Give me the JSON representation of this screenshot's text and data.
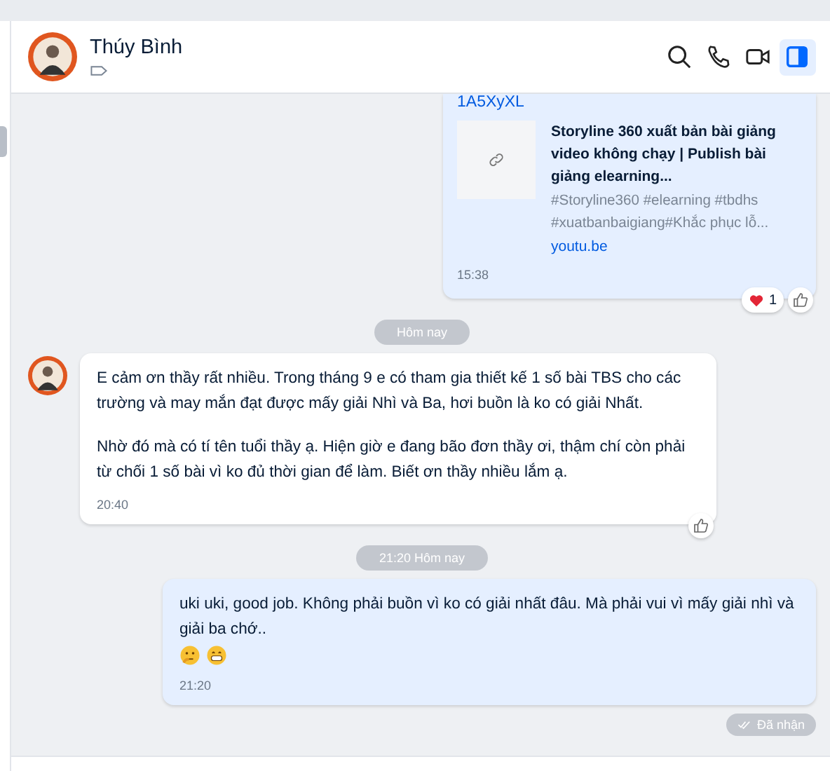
{
  "header": {
    "name": "Thúy Bình",
    "actions": [
      {
        "kind": "search",
        "selected": false
      },
      {
        "kind": "call",
        "selected": false
      },
      {
        "kind": "video",
        "selected": false
      },
      {
        "kind": "panel",
        "selected": true
      }
    ]
  },
  "messages": [
    {
      "kind": "link",
      "outgoing": true,
      "url_text": "1A5XyXL",
      "title": "Storyline 360 xuất bản bài giảng video không chạy | Publish bài giảng elearning...",
      "description": "#Storyline360 #elearning #tbdhs #xuatbanbaigiang#Khắc phục lỗ...",
      "domain": "youtu.be",
      "time": "15:38",
      "reactions": [
        {
          "kind": "heart",
          "count": "1"
        }
      ]
    },
    {
      "kind": "divider",
      "label": "Hôm nay"
    },
    {
      "kind": "text",
      "outgoing": false,
      "paragraphs": [
        "E cảm ơn thầy rất nhiều. Trong tháng 9 e có tham gia thiết kế 1 số bài TBS cho các trường và may mắn đạt được mấy giải Nhì và Ba, hơi buồn là ko có giải Nhất.",
        "Nhờ đó mà có tí tên tuổi thầy ạ. Hiện giờ e đang bão đơn thầy ơi, thậm chí còn phải từ chối 1 số bài vì ko đủ thời gian để làm. Biết ơn thầy nhiều lắm ạ."
      ],
      "time": "20:40"
    },
    {
      "kind": "divider",
      "label": "21:20 Hôm nay"
    },
    {
      "kind": "text",
      "outgoing": true,
      "paragraphs": [
        "uki uki, good job. Không phải buồn vì ko có giải nhất đâu. Mà phải vui vì mấy giải nhì và giải ba chớ.."
      ],
      "emojis": [
        {
          "kind": "thinking"
        },
        {
          "kind": "grin"
        }
      ],
      "time": "21:20",
      "status": "Đã nhận"
    }
  ]
}
